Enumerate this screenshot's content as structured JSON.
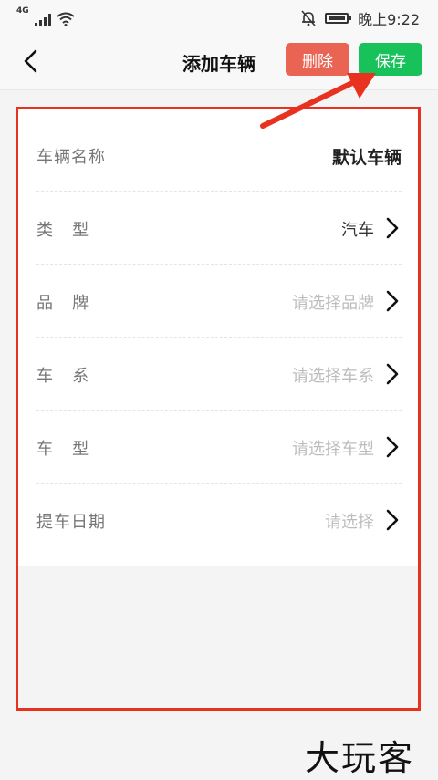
{
  "status_bar": {
    "network": "4G",
    "time": "晚上9:22"
  },
  "nav": {
    "title": "添加车辆",
    "delete_label": "删除",
    "save_label": "保存"
  },
  "form": {
    "rows": [
      {
        "label": "车辆名称",
        "value": "默认车辆",
        "state": "filled",
        "chevron": false
      },
      {
        "label": "类   型",
        "value": "汽车",
        "state": "filled",
        "chevron": true
      },
      {
        "label": "品   牌",
        "value": "请选择品牌",
        "state": "placeholder",
        "chevron": true
      },
      {
        "label": "车   系",
        "value": "请选择车系",
        "state": "placeholder",
        "chevron": true
      },
      {
        "label": "车   型",
        "value": "请选择车型",
        "state": "placeholder",
        "chevron": true
      },
      {
        "label": "提车日期",
        "value": "请选择",
        "state": "placeholder",
        "chevron": true
      }
    ]
  },
  "watermark": "大玩客",
  "colors": {
    "delete": "#e96452",
    "save": "#18c25a",
    "annotation": "#e8321f"
  },
  "icons": [
    "signal-icon",
    "wifi-icon",
    "mute-icon",
    "battery-icon",
    "back-chevron-icon",
    "chevron-right-icon",
    "arrow-annotation-icon"
  ]
}
